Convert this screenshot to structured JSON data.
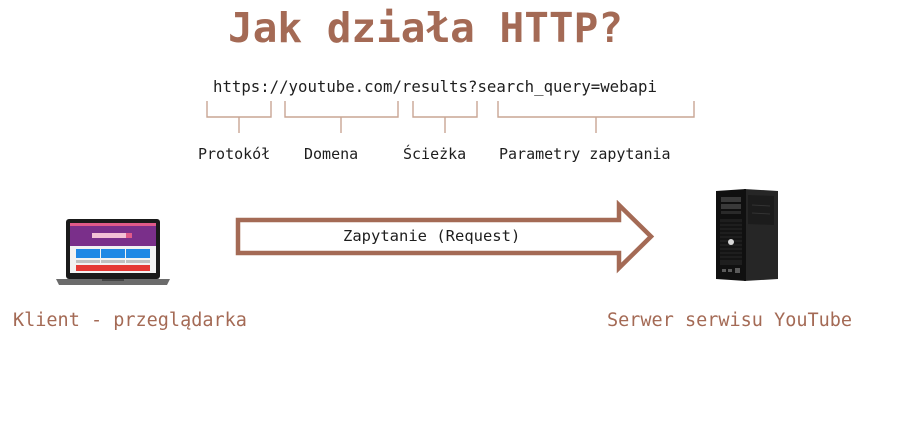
{
  "title": "Jak działa HTTP?",
  "url": "https://youtube.com/results?search_query=webapi",
  "url_parts": [
    {
      "label": "Protokół"
    },
    {
      "label": "Domena"
    },
    {
      "label": "Ścieżka"
    },
    {
      "label": "Parametry zapytania"
    }
  ],
  "request": {
    "label": "Zapytanie (Request)"
  },
  "client": {
    "label": "Klient - przeglądarka",
    "icon": "laptop-icon"
  },
  "server": {
    "label": "Serwer serwisu YouTube",
    "icon": "server-tower-icon"
  },
  "colors": {
    "accent": "#a46a55",
    "text": "#1e1e1e",
    "bracket": "#c9a594"
  }
}
